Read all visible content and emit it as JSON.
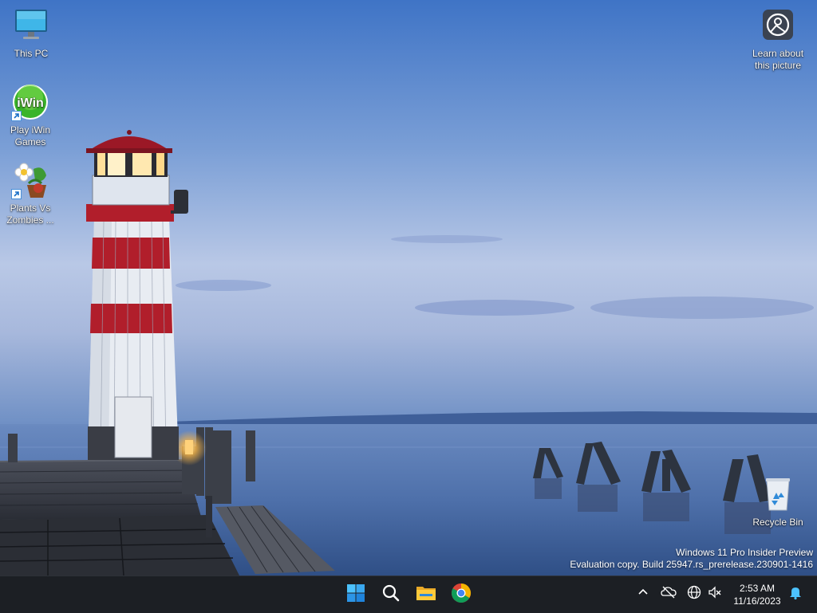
{
  "desktop": {
    "icons": [
      {
        "label": "This PC",
        "icon": "monitor-icon"
      },
      {
        "label": "Play iWin Games",
        "icon_text": "iWin",
        "icon": "iwin-logo-icon",
        "shortcut": true
      },
      {
        "label": "Plants Vs Zombies ...",
        "icon": "plants-vs-zombies-icon",
        "shortcut": true
      },
      {
        "label": "Learn about this picture",
        "icon": "camera-lens-icon"
      },
      {
        "label": "Recycle Bin",
        "icon": "recycle-bin-icon"
      }
    ],
    "watermark": {
      "line1": "Windows 11 Pro Insider Preview",
      "line2": "Evaluation copy. Build 25947.rs_prerelease.230901-1416"
    }
  },
  "taskbar": {
    "center": [
      {
        "icon": "windows-start-icon"
      },
      {
        "icon": "search-icon"
      },
      {
        "icon": "file-explorer-icon"
      },
      {
        "icon": "chrome-icon"
      }
    ],
    "tray": [
      {
        "icon": "chevron-up-icon"
      },
      {
        "icon": "onedrive-offline-icon"
      },
      {
        "icon": "network-globe-icon"
      },
      {
        "icon": "speaker-muted-icon"
      }
    ],
    "time": "2:53 AM",
    "date": "11/16/2023",
    "notification_icon": "bell-icon"
  },
  "colors": {
    "taskbar_bg": "#1c1f24",
    "accent": "#4cc2ff",
    "lighthouse_red": "#b11e2b"
  }
}
